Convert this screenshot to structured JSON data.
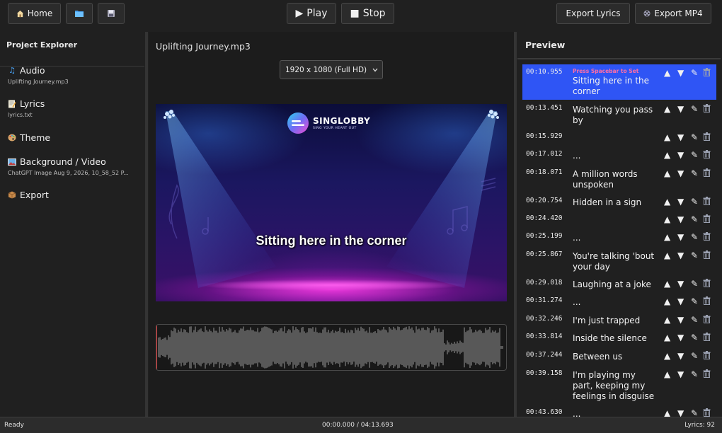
{
  "toolbar": {
    "home_label": "Home",
    "home_icon": "house-icon",
    "open_icon": "folder-icon",
    "save_icon": "floppy-disk-icon",
    "play_label": "Play",
    "play_glyph": "▶",
    "stop_label": "Stop",
    "stop_glyph": "■",
    "export_lyrics_label": "Export Lyrics",
    "export_mp4_label": "Export MP4",
    "export_mp4_icon": "film-reel-icon"
  },
  "explorer": {
    "title": "Project Explorer",
    "items": [
      {
        "label": "Audio",
        "icon": "music-note-icon",
        "sub": "Uplifting Journey.mp3"
      },
      {
        "label": "Lyrics",
        "icon": "memo-icon",
        "sub": "lyrics.txt"
      },
      {
        "label": "Theme",
        "icon": "palette-icon",
        "sub": ""
      },
      {
        "label": "Background / Video",
        "icon": "picture-icon",
        "sub": "ChatGPT Image Aug 9, 2026, 10_58_52 P..."
      },
      {
        "label": "Export",
        "icon": "package-icon",
        "sub": ""
      }
    ]
  },
  "editor": {
    "filename": "Uplifting Journey.mp3",
    "resolution_selected": "1920 x 1080 (Full HD)",
    "brand_name": "SINGLOBBY",
    "brand_tagline": "SING YOUR HEART OUT",
    "current_lyric": "Sitting here in the corner"
  },
  "preview": {
    "title": "Preview",
    "hint": "Press Spacebar to Set",
    "rows": [
      {
        "time": "00:10.955",
        "text": "Sitting here in the corner"
      },
      {
        "time": "00:13.451",
        "text": "Watching you pass by"
      },
      {
        "time": "00:15.929",
        "text": ""
      },
      {
        "time": "00:17.012",
        "text": "..."
      },
      {
        "time": "00:18.071",
        "text": "A million words unspoken"
      },
      {
        "time": "00:20.754",
        "text": "Hidden in a sign"
      },
      {
        "time": "00:24.420",
        "text": ""
      },
      {
        "time": "00:25.199",
        "text": "..."
      },
      {
        "time": "00:25.867",
        "text": "You're talking 'bout your day"
      },
      {
        "time": "00:29.018",
        "text": "Laughing at a joke"
      },
      {
        "time": "00:31.274",
        "text": "..."
      },
      {
        "time": "00:32.246",
        "text": "I'm just trapped"
      },
      {
        "time": "00:33.814",
        "text": "Inside the silence"
      },
      {
        "time": "00:37.244",
        "text": "Between us"
      },
      {
        "time": "00:39.158",
        "text": "I'm playing my part, keeping my feelings in disguise"
      },
      {
        "time": "00:43.630",
        "text": "..."
      }
    ],
    "controls": {
      "up": "▲",
      "down": "▼",
      "edit": "✎",
      "delete_icon": "trash-can-icon"
    }
  },
  "status": {
    "left": "Ready",
    "center": "00:00.000 / 04:13.693",
    "right": "Lyrics: 92"
  },
  "colors": {
    "active_row": "#2f55f5",
    "hint": "#ff6fa5",
    "background": "#202020"
  }
}
